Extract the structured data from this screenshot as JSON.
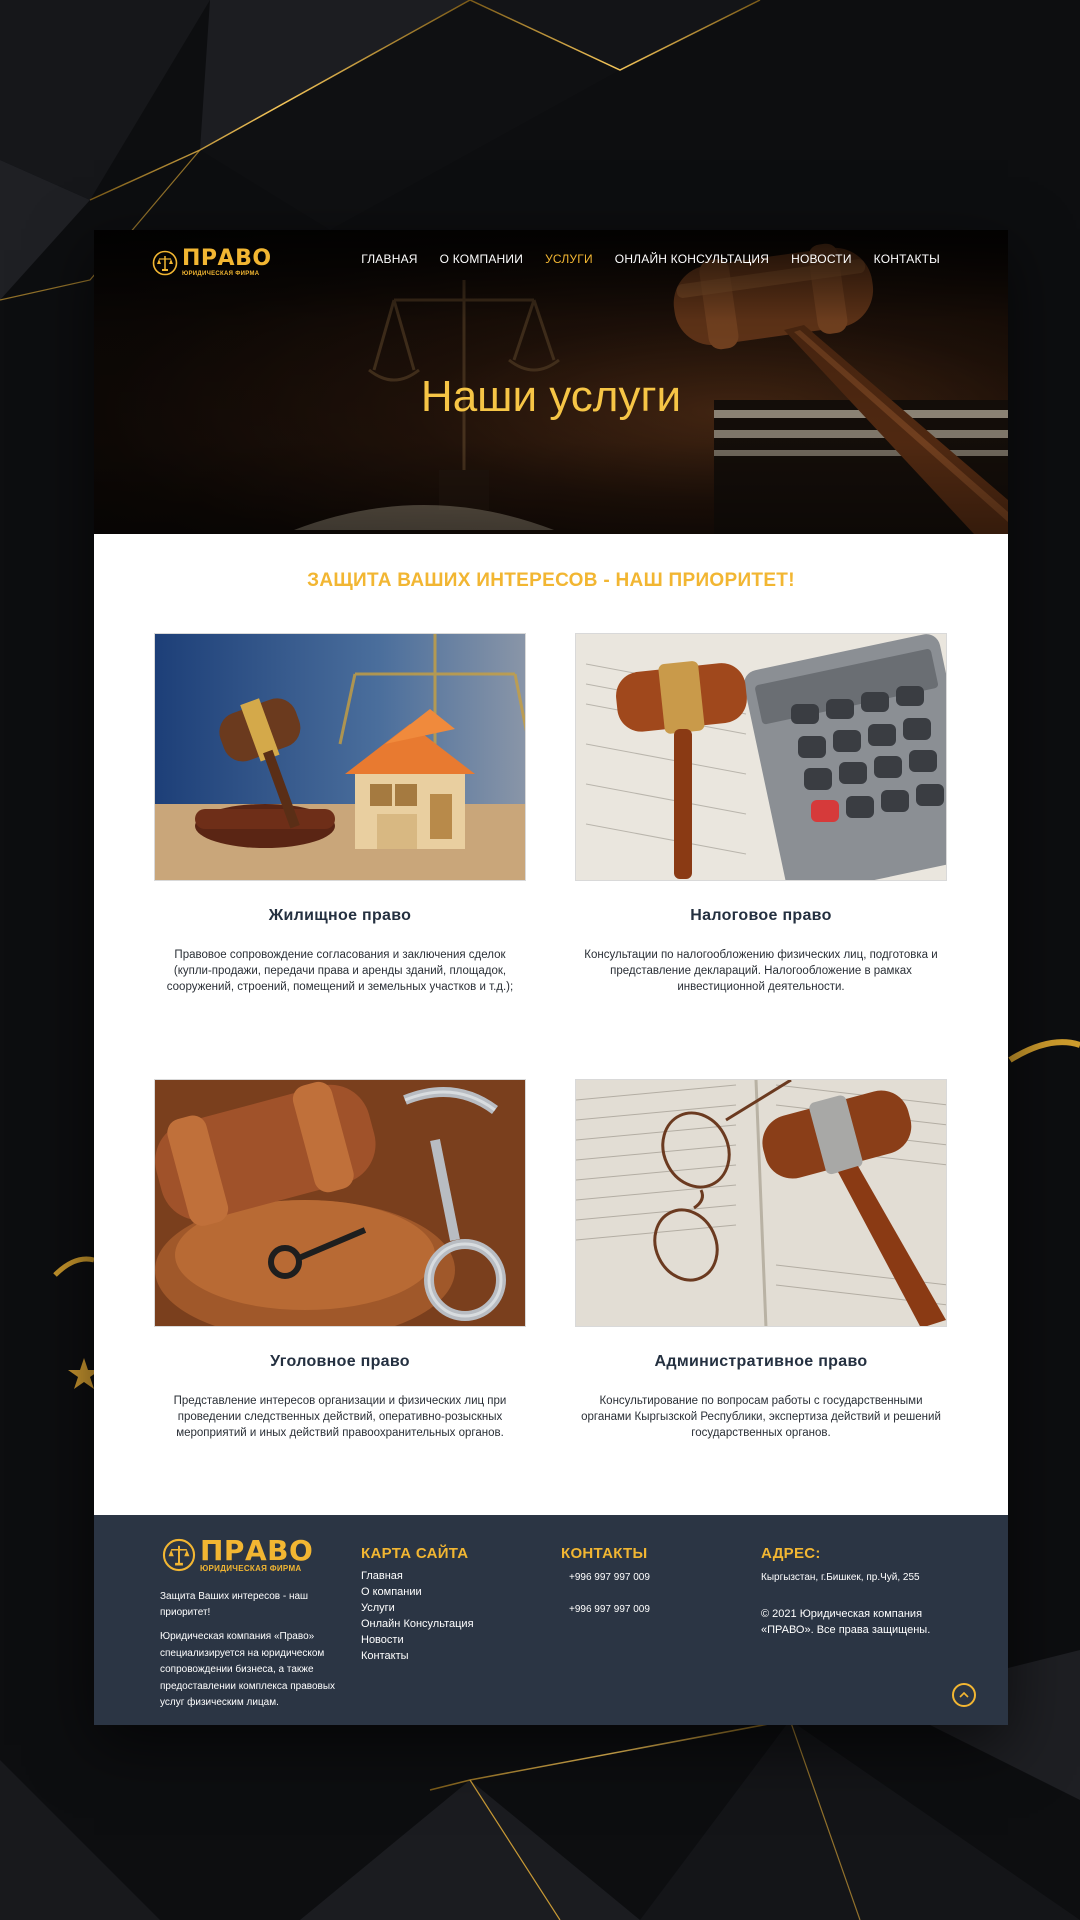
{
  "brand": {
    "name": "ПРАВО",
    "subtitle": "ЮРИДИЧЕСКАЯ ФИРМА",
    "accent": "#f2b632"
  },
  "nav": {
    "items": [
      {
        "label": "ГЛАВНАЯ",
        "active": false
      },
      {
        "label": "О КОМПАНИИ",
        "active": false
      },
      {
        "label": "УСЛУГИ",
        "active": true
      },
      {
        "label": "ОНЛАЙН КОНСУЛЬТАЦИЯ",
        "active": false
      },
      {
        "label": "НОВОСТИ",
        "active": false
      },
      {
        "label": "КОНТАКТЫ",
        "active": false
      }
    ]
  },
  "hero": {
    "title": "Наши услуги"
  },
  "slogan": "ЗАЩИТА ВАШИХ ИНТЕРЕСОВ - НАШ ПРИОРИТЕТ!",
  "services": [
    {
      "title": "Жилищное право",
      "text": "Правовое сопровождение согласования и заключения сделок (купли-продажи, передачи права и аренды зданий, площадок, сооружений, строений, помещений и земельных участков и т.д.);",
      "icon": "house-gavel-photo"
    },
    {
      "title": "Налоговое право",
      "text": "Консультации по налогообложению физических лиц, подготовка и представление деклараций. Налогообложение в рамках инвестиционной деятельности.",
      "icon": "calculator-gavel-photo"
    },
    {
      "title": "Уголовное право",
      "text": "Представление интересов организации и физических лиц при проведении следственных действий, оперативно-розыскных мероприятий и иных действий правоохранительных органов.",
      "icon": "handcuffs-gavel-photo"
    },
    {
      "title": "Административное право",
      "text": "Консультирование по вопросам работы с государственными органами Кыргызской Республики, экспертиза действий и решений государственных органов.",
      "icon": "glasses-gavel-photo"
    }
  ],
  "footer": {
    "tagline": "Защита Ваших интересов - наш приоритет!",
    "about": "Юридическая компания «Право» специализируется на юридическом сопровождении бизнеса, а также предоставлении комплекса правовых услуг физическим лицам.",
    "sitemap_heading": "КАРТА САЙТА",
    "sitemap": [
      "Главная",
      "О компании",
      "Услуги",
      "Онлайн Консультация",
      "Новости",
      "Контакты"
    ],
    "contacts_heading": "КОНТАКТЫ",
    "phones": [
      "+996 997 997 009",
      "+996 997 997 009"
    ],
    "address_heading": "АДРЕС:",
    "address": "Кыргызстан, г.Бишкек, пр.Чуй, 255",
    "copyright": "© 2021 Юридическая компания «ПРАВО». Все права защищены."
  }
}
